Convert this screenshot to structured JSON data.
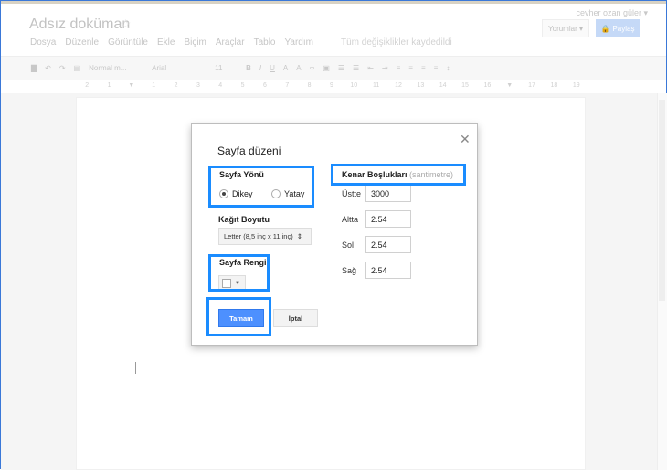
{
  "header": {
    "user": "cevher ozan güler ▾",
    "title": "Adsız doküman",
    "comments": "Yorumlar ▾",
    "share": "Paylaş",
    "menu": [
      "Dosya",
      "Düzenle",
      "Görüntüle",
      "Ekle",
      "Biçim",
      "Araçlar",
      "Tablo",
      "Yardım"
    ],
    "save_status": "Tüm değişiklikler kaydedildi"
  },
  "toolbar": {
    "style": "Normal m...",
    "font": "Arial",
    "size": "11"
  },
  "ruler": [
    "2",
    "1",
    "▼",
    "1",
    "2",
    "3",
    "4",
    "5",
    "6",
    "7",
    "8",
    "9",
    "10",
    "11",
    "12",
    "13",
    "14",
    "15",
    "16",
    "▼",
    "17",
    "18",
    "19"
  ],
  "dialog": {
    "title": "Sayfa düzeni",
    "orientation": {
      "label": "Sayfa Yönü",
      "options": [
        "Dikey",
        "Yatay"
      ],
      "selected": "Dikey"
    },
    "paper": {
      "label": "Kağıt Boyutu",
      "value": "Letter (8,5 inç x 11 inç)"
    },
    "color": {
      "label": "Sayfa Rengi",
      "value": "#ffffff"
    },
    "margins": {
      "label": "Kenar Boşlukları",
      "unit": "(santimetre)",
      "fields": [
        {
          "label": "Üstte",
          "value": "3000"
        },
        {
          "label": "Altta",
          "value": "2.54"
        },
        {
          "label": "Sol",
          "value": "2.54"
        },
        {
          "label": "Sağ",
          "value": "2.54"
        }
      ]
    },
    "ok": "Tamam",
    "cancel": "İptal"
  },
  "colors": {
    "highlight": "#1a8cff",
    "primary": "#4d90fe"
  }
}
